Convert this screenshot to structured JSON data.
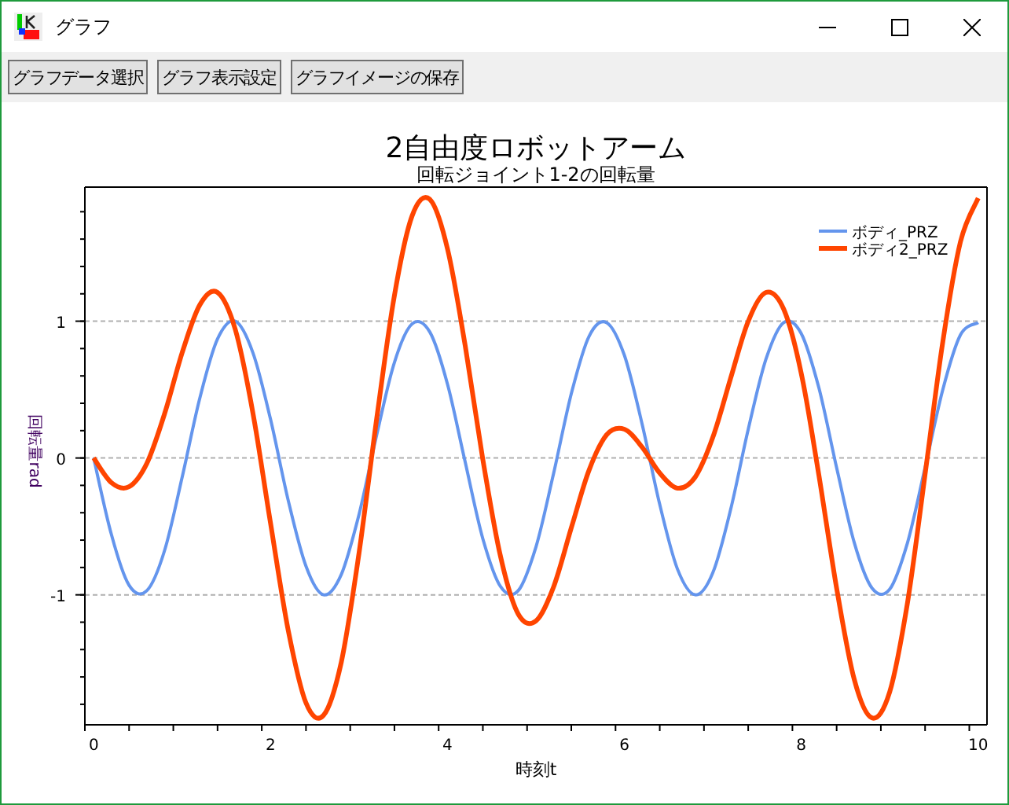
{
  "window": {
    "title": "グラフ"
  },
  "toolbar": {
    "buttons": [
      "グラフデータ選択",
      "グラフ表示設定",
      "グラフイメージの保存"
    ]
  },
  "graph": {
    "subtitle": "回転ジョイント1-2の回転量",
    "chart_data": {
      "type": "line",
      "title": "2自由度ロボットアーム",
      "xlabel": "時刻t",
      "ylabel": "回転量rad",
      "x": [
        0,
        0.2,
        0.4,
        0.6,
        0.8,
        1,
        1.2,
        1.4,
        1.6,
        1.8,
        2,
        2.2,
        2.4,
        2.6,
        2.8,
        3,
        3.2,
        3.4,
        3.6,
        3.8,
        4,
        4.2,
        4.4,
        4.6,
        4.8,
        5,
        5.2,
        5.4,
        5.6,
        5.8,
        6,
        6.2,
        6.4,
        6.6,
        6.8,
        7,
        7.2,
        7.4,
        7.6,
        7.8,
        8,
        8.2,
        8.4,
        8.6,
        8.8,
        9,
        9.2,
        9.4,
        9.6,
        9.8,
        10
      ],
      "series": [
        {
          "name": "ボディ_PRZ",
          "color": "#6495ed",
          "values": [
            0,
            -0.56,
            -0.93,
            -0.97,
            -0.68,
            -0.14,
            0.44,
            0.87,
            1.0,
            0.77,
            0.28,
            -0.31,
            -0.79,
            -1.0,
            -0.85,
            -0.41,
            0.17,
            0.7,
            0.98,
            0.92,
            0.54,
            -0.03,
            -0.59,
            -0.94,
            -0.97,
            -0.65,
            -0.11,
            0.47,
            0.89,
            0.99,
            0.75,
            0.25,
            -0.34,
            -0.81,
            -1.0,
            -0.84,
            -0.38,
            0.21,
            0.72,
            0.99,
            0.91,
            0.51,
            -0.07,
            -0.62,
            -0.95,
            -0.96,
            -0.62,
            -0.07,
            0.5,
            0.9,
            0.99
          ]
        },
        {
          "name": "ボディ2_PRZ",
          "color": "#ff4500",
          "values": [
            0,
            -0.18,
            -0.21,
            -0.04,
            0.32,
            0.77,
            1.12,
            1.21,
            0.94,
            0.33,
            -0.48,
            -1.26,
            -1.79,
            -1.88,
            -1.49,
            -0.69,
            0.29,
            1.19,
            1.77,
            1.89,
            1.53,
            0.82,
            -0.01,
            -0.72,
            -1.14,
            -1.19,
            -0.94,
            -0.51,
            -0.09,
            0.17,
            0.21,
            0.08,
            -0.11,
            -0.22,
            -0.14,
            0.15,
            0.58,
            1.0,
            1.21,
            1.09,
            0.62,
            -0.13,
            -0.95,
            -1.62,
            -1.9,
            -1.71,
            -1.06,
            -0.12,
            0.85,
            1.58,
            1.9
          ]
        }
      ],
      "xlim": [
        -0.1,
        10.1
      ],
      "grid": true,
      "legend": true,
      "ylim": [
        -1.95,
        1.98
      ],
      "xticks": [
        0,
        2,
        4,
        6,
        8,
        10
      ],
      "yticks": [
        -1,
        0,
        1
      ]
    }
  }
}
